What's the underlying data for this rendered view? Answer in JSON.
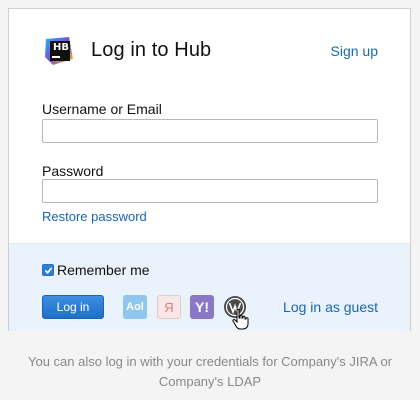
{
  "header": {
    "logo_text": "HB",
    "title": "Log in to Hub",
    "signup_label": "Sign up"
  },
  "form": {
    "username_label": "Username or Email",
    "username_value": "",
    "password_label": "Password",
    "password_value": "",
    "restore_label": "Restore password"
  },
  "footer": {
    "remember_label": "Remember me",
    "remember_checked": true,
    "login_button": "Log in",
    "providers": {
      "aol": "Aol",
      "yandex": "Я",
      "yahoo": "Y!",
      "wordpress": "wordpress-icon"
    },
    "guest_label": "Log in as guest"
  },
  "note": {
    "line1": "You can also log in with your credentials for Company's JIRA or",
    "line2": "Company's LDAP"
  },
  "colors": {
    "link": "#1a66b5",
    "footer_bg": "#eaf3fb",
    "button": "#2a7bd4",
    "page_bg": "#f4f4f4"
  }
}
